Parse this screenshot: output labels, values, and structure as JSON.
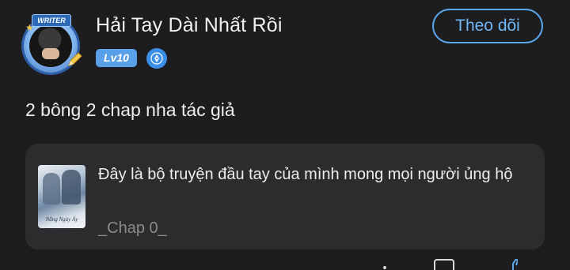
{
  "user": {
    "name": "Hải Tay Dài Nhất Rồi",
    "avatar_badge": "WRITER",
    "level": "Lv10",
    "verify_icon": "pen-nib-icon"
  },
  "follow_button": {
    "label": "Theo dõi"
  },
  "comment": {
    "text": "2 bông 2 chap nha tác giả"
  },
  "story": {
    "title": "Đây là bộ truyện đầu tay của mình mong mọi người ủng hộ",
    "chapter": "_Chap 0_",
    "cover_caption": "Nắng Ngày Ấy"
  },
  "bottom_actions": [
    "more-icon",
    "comment-icon",
    "like-icon"
  ],
  "colors": {
    "background": "#1d1d1f",
    "card": "#2c2c2e",
    "accent": "#5aa8f0",
    "level_badge": "#5aa0e8",
    "muted_text": "#8b8b8e"
  }
}
